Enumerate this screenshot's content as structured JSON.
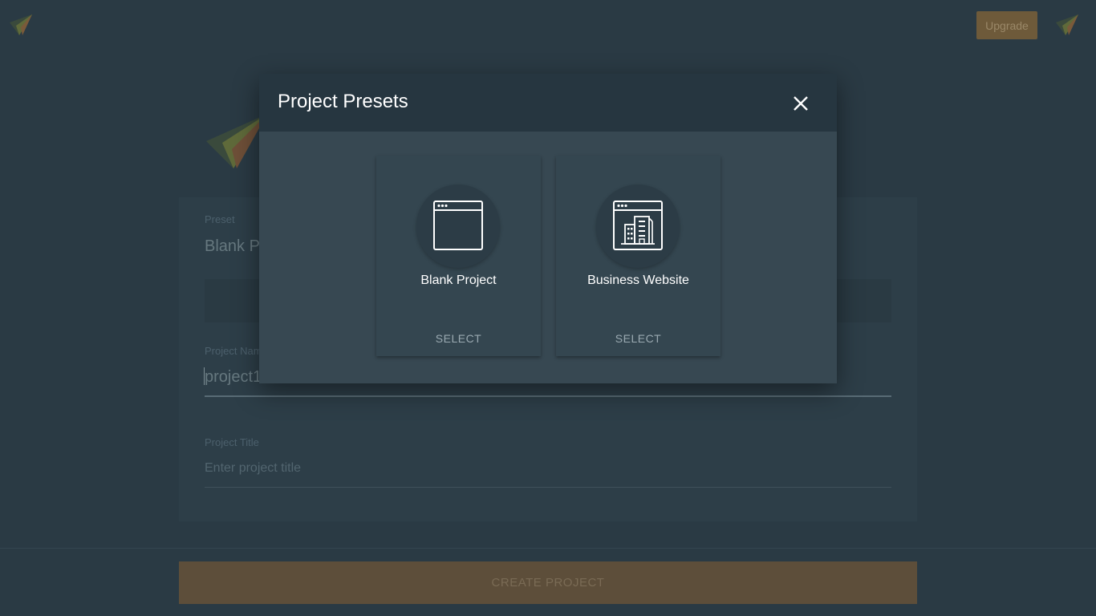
{
  "topbar": {
    "upgrade_label": "Upgrade",
    "logo_left_icon": "paper-plane-logo-icon",
    "logo_right_icon": "paper-plane-logo-icon"
  },
  "form": {
    "preset_label": "Preset",
    "preset_value": "Blank Project",
    "project_name_label": "Project Name",
    "project_name_value": "project1",
    "project_title_label": "Project Title",
    "project_title_placeholder": "Enter project title"
  },
  "footer": {
    "create_label": "CREATE PROJECT"
  },
  "modal": {
    "title": "Project Presets",
    "close_icon": "close-icon",
    "presets": [
      {
        "name": "Blank Project",
        "action": "SELECT",
        "icon": "browser-window-icon"
      },
      {
        "name": "Business Website",
        "action": "SELECT",
        "icon": "browser-building-icon"
      }
    ]
  },
  "colors": {
    "background": "#2a3a44",
    "modal_header": "#263640",
    "modal_body": "#374852",
    "card": "#344650",
    "accent_muted": "#6e5a3a"
  }
}
